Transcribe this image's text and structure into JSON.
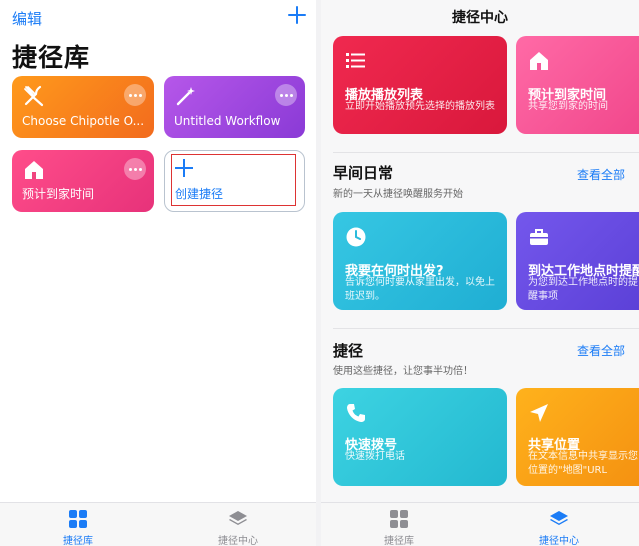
{
  "left": {
    "edit_label": "编辑",
    "library_title": "捷径库",
    "cards": [
      {
        "title": "Choose Chipotle O...",
        "icon": "utensils-icon",
        "color": "#f47a1d"
      },
      {
        "title": "Untitled Workflow",
        "icon": "magic-wand-icon",
        "color": "#9b45de"
      },
      {
        "title": "预计到家时间",
        "icon": "home-icon",
        "color": "#f0457f"
      }
    ],
    "create_label": "创建捷径",
    "tabs": [
      {
        "label": "捷径库",
        "icon": "grid-icon",
        "active": true
      },
      {
        "label": "捷径中心",
        "icon": "layers-icon",
        "active": false
      }
    ]
  },
  "right": {
    "header_title": "捷径中心",
    "featured": [
      {
        "title": "播放播放列表",
        "desc": "立即开始播放预先选择的播放列表",
        "icon": "list-icon",
        "color": "#e8223f"
      },
      {
        "title": "预计到家时间",
        "desc": "共享您到家的时间",
        "icon": "home-icon",
        "color": "#f5589a"
      }
    ],
    "sections": [
      {
        "title": "早间日常",
        "subtitle": "新的一天从捷径唤醒服务开始",
        "link": "查看全部",
        "cards": [
          {
            "title": "我要在何时出发?",
            "desc": "告诉您何时要从家里出发，以免上班迟到。",
            "icon": "clock-icon",
            "color": "#2abbdc"
          },
          {
            "title": "到达工作地点时提醒",
            "desc": "为您到达工作地点时的提醒事项",
            "icon": "briefcase-icon",
            "color": "#6549e0"
          }
        ]
      },
      {
        "title": "捷径",
        "subtitle": "使用这些捷径，让您事半功倍！",
        "link": "查看全部",
        "cards": [
          {
            "title": "快速拨号",
            "desc": "快速拨打电话",
            "icon": "phone-icon",
            "color": "#2cc3d9"
          },
          {
            "title": "共享位置",
            "desc": "在文本信息中共享显示您位置的\"地图\"URL",
            "icon": "location-arrow-icon",
            "color": "#fba216"
          }
        ]
      }
    ],
    "tabs": [
      {
        "label": "捷径库",
        "icon": "grid-icon",
        "active": false
      },
      {
        "label": "捷径中心",
        "icon": "layers-icon",
        "active": true
      }
    ]
  },
  "colors": {
    "accent": "#1b7cf6",
    "inactive_tab": "#8e8e93"
  }
}
